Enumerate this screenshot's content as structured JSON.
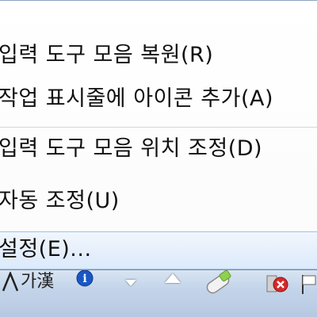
{
  "context_menu": {
    "items": [
      {
        "label": "입력 도구 모음 복원(R)"
      },
      {
        "label": "작업 표시줄에 아이콘 추가(A)"
      },
      {
        "label": "입력 도구 모음 위치 조정(D)"
      },
      {
        "label": "자동 조정(U)"
      },
      {
        "label": "설정(E)..."
      }
    ]
  },
  "taskbar": {
    "ime_indicator": "가漢",
    "icons": [
      "input-mode-icon",
      "help-icon",
      "chevron-down-icon",
      "show-hidden-icons-up-icon",
      "usb-device-icon",
      "error-icon",
      "flag-icon"
    ],
    "colors": {
      "help_blue": "#1a57c4",
      "error_red": "#d42a2a",
      "hover_blue": "#dceafb"
    }
  }
}
